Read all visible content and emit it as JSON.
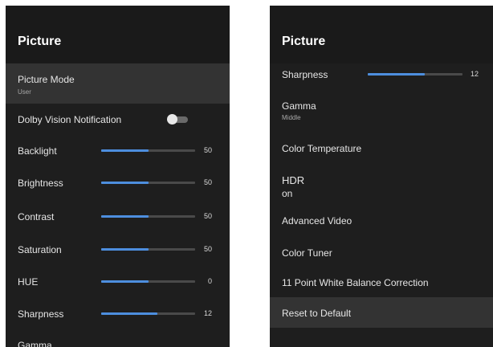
{
  "left_panel": {
    "title": "Picture",
    "picture_mode": {
      "label": "Picture Mode",
      "value": "User"
    },
    "dolby_vision": {
      "label": "Dolby Vision Notification",
      "enabled": false
    },
    "sliders": [
      {
        "label": "Backlight",
        "value": "50",
        "level": 0.5
      },
      {
        "label": "Brightness",
        "value": "50",
        "level": 0.5
      },
      {
        "label": "Contrast",
        "value": "50",
        "level": 0.5
      },
      {
        "label": "Saturation",
        "value": "50",
        "level": 0.5
      },
      {
        "label": "HUE",
        "value": "0",
        "level": 0.5
      },
      {
        "label": "Sharpness",
        "value": "12",
        "level": 0.6
      }
    ],
    "gamma_label": "Gamma"
  },
  "right_panel": {
    "title": "Picture",
    "sharpness": {
      "label": "Sharpness",
      "value": "12",
      "level": 0.6
    },
    "gamma": {
      "label": "Gamma",
      "value": "Middle"
    },
    "color_temperature": "Color Temperature",
    "hdr": {
      "label": "HDR",
      "value": "on"
    },
    "advanced_video": "Advanced Video",
    "color_tuner": "Color Tuner",
    "white_balance": "11 Point White Balance Correction",
    "reset": "Reset to Default"
  },
  "colors": {
    "panel_bg": "#1e1e1e",
    "highlight_bg": "#333333",
    "slider_fill": "#4d8ede",
    "slider_track": "#4a4a4a"
  }
}
